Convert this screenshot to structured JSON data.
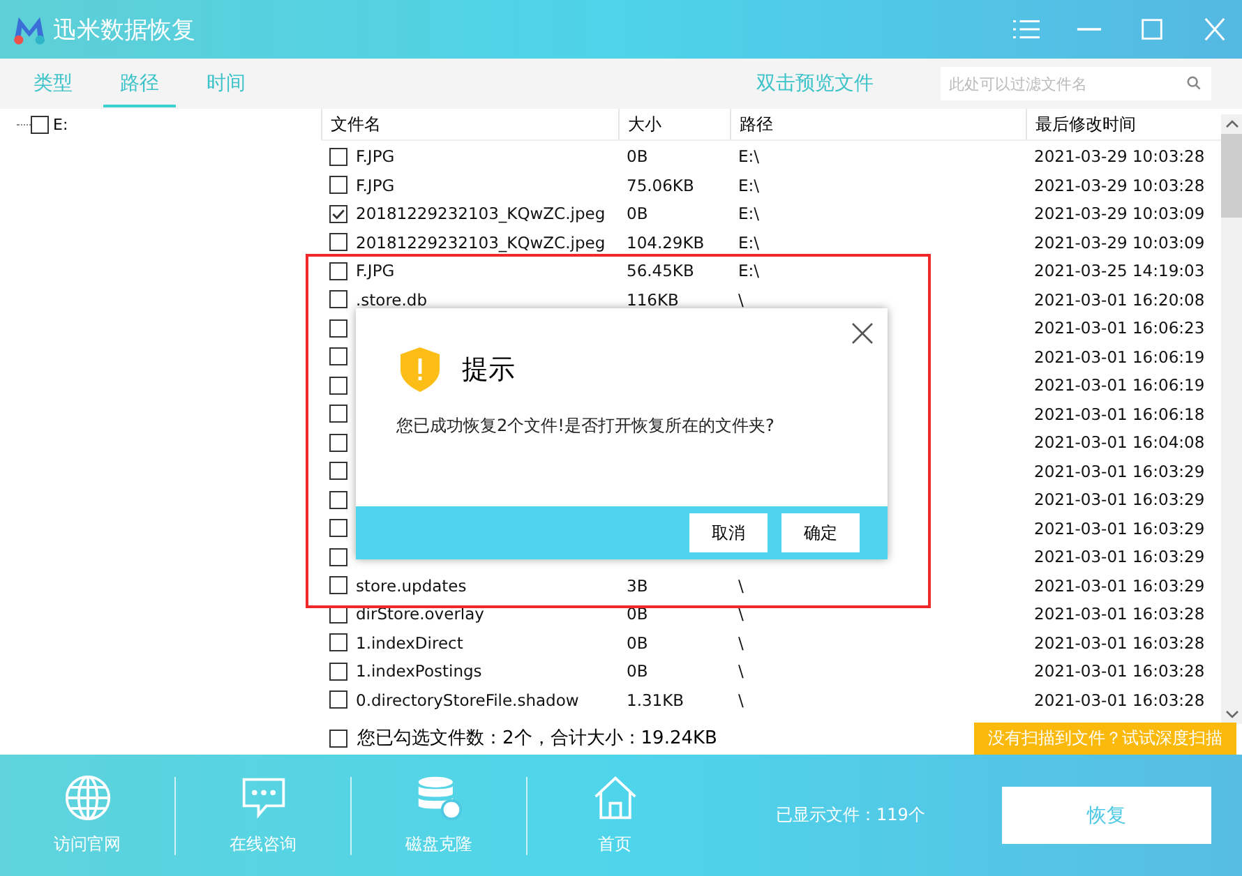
{
  "window": {
    "title": "迅米数据恢复"
  },
  "tabs": [
    {
      "label": "类型",
      "selected": false
    },
    {
      "label": "路径",
      "selected": true
    },
    {
      "label": "时间",
      "selected": false
    }
  ],
  "preview_hint": "双击预览文件",
  "filter": {
    "placeholder": "此处可以过滤文件名"
  },
  "tree": [
    {
      "label": "E:",
      "checked": false
    }
  ],
  "table": {
    "columns": [
      "文件名",
      "大小",
      "路径",
      "最后修改时间"
    ],
    "rows": [
      {
        "checked": false,
        "name": "F.JPG",
        "size": "0B",
        "path": "E:\\",
        "time": "2021-03-29 10:03:28"
      },
      {
        "checked": false,
        "name": "F.JPG",
        "size": "75.06KB",
        "path": "E:\\",
        "time": "2021-03-29 10:03:28"
      },
      {
        "checked": true,
        "name": "20181229232103_KQwZC.jpeg",
        "size": "0B",
        "path": "E:\\",
        "time": "2021-03-29 10:03:09"
      },
      {
        "checked": false,
        "name": "20181229232103_KQwZC.jpeg",
        "size": "104.29KB",
        "path": "E:\\",
        "time": "2021-03-29 10:03:09"
      },
      {
        "checked": false,
        "name": "F.JPG",
        "size": "56.45KB",
        "path": "E:\\",
        "time": "2021-03-25 14:19:03"
      },
      {
        "checked": false,
        "name": ".store.db",
        "size": "116KB",
        "path": "\\",
        "time": "2021-03-01 16:20:08"
      },
      {
        "checked": false,
        "time": "2021-03-01 16:06:23"
      },
      {
        "checked": false,
        "time": "2021-03-01 16:06:19"
      },
      {
        "checked": false,
        "time": "2021-03-01 16:06:19"
      },
      {
        "checked": false,
        "time": "2021-03-01 16:06:18"
      },
      {
        "checked": false,
        "time": "2021-03-01 16:04:08"
      },
      {
        "checked": false,
        "time": "2021-03-01 16:03:29"
      },
      {
        "checked": false,
        "time": "2021-03-01 16:03:29"
      },
      {
        "checked": false,
        "time": "2021-03-01 16:03:29"
      },
      {
        "checked": false,
        "time": "2021-03-01 16:03:29"
      },
      {
        "checked": false,
        "name": "store.updates",
        "size": "3B",
        "path": "\\",
        "time": "2021-03-01 16:03:29"
      },
      {
        "checked": false,
        "name": "dirStore.overlay",
        "size": "0B",
        "path": "\\",
        "time": "2021-03-01 16:03:28"
      },
      {
        "checked": false,
        "name": "1.indexDirect",
        "size": "0B",
        "path": "\\",
        "time": "2021-03-01 16:03:28"
      },
      {
        "checked": false,
        "name": "1.indexPostings",
        "size": "0B",
        "path": "\\",
        "time": "2021-03-01 16:03:28"
      },
      {
        "checked": false,
        "name": "0.directoryStoreFile.shadow",
        "size": "1.31KB",
        "path": "\\",
        "time": "2021-03-01 16:03:28"
      }
    ]
  },
  "selection_summary": {
    "checked": false,
    "text": "您已勾选文件数：2个，合计大小：19.24KB"
  },
  "deep_scan_button": "没有扫描到文件？试试深度扫描",
  "dialog": {
    "title": "提示",
    "message": "您已成功恢复2个文件!是否打开恢复所在的文件夹?",
    "buttons": [
      "取消",
      "确定"
    ]
  },
  "bottom_nav": [
    {
      "kind": "globe",
      "label": "访问官网"
    },
    {
      "kind": "chat",
      "label": "在线咨询"
    },
    {
      "kind": "disk",
      "label": "磁盘克隆"
    },
    {
      "kind": "home",
      "label": "首页"
    }
  ],
  "file_count": "已显示文件：119个",
  "recover_button": "恢复"
}
